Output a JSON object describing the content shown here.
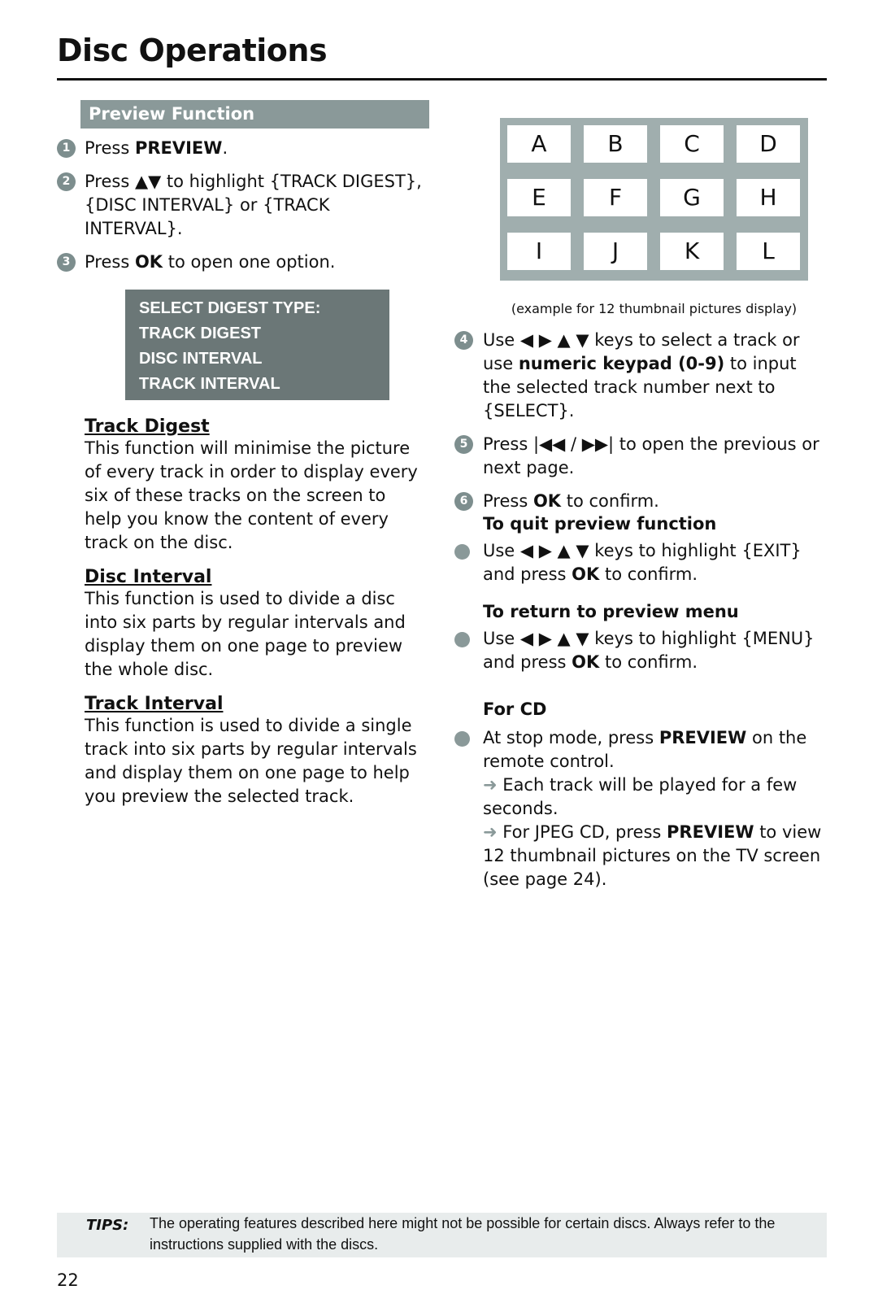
{
  "header": {
    "title": "Disc Operations"
  },
  "section": {
    "title": "Preview Function"
  },
  "steps_left": [
    {
      "num": "1",
      "pre": "Press ",
      "bold": "PREVIEW",
      "post": "."
    },
    {
      "num": "2",
      "text": "Press ▲▼ to highlight {TRACK DIGEST}, {DISC INTERVAL} or {TRACK INTERVAL}."
    },
    {
      "num": "3",
      "pre": "Press ",
      "bold": "OK",
      "post": " to open one option."
    }
  ],
  "menu": {
    "items": [
      "SELECT DIGEST TYPE:",
      "TRACK DIGEST",
      "DISC INTERVAL",
      "TRACK INTERVAL"
    ]
  },
  "descriptions": [
    {
      "heading": "Track Digest",
      "text": "This function will minimise the picture of every track in order to display every six of these tracks on the screen to help you know the content of every track on the disc."
    },
    {
      "heading": "Disc Interval",
      "text": "This function is used to divide a disc into six parts by regular intervals and display them on one page to preview the whole disc."
    },
    {
      "heading": "Track Interval",
      "text": "This function is used to divide a single track into six parts by regular intervals and display them on one page to help you preview the selected track."
    }
  ],
  "thumbnail_grid": {
    "cells": [
      "A",
      "B",
      "C",
      "D",
      "E",
      "F",
      "G",
      "H",
      "I",
      "J",
      "K",
      "L"
    ],
    "caption": "(example for 12 thumbnail pictures display)"
  },
  "steps_right": [
    {
      "num": "4",
      "pre": "Use ◀ ▶ ▲ ▼ keys to select a track or use ",
      "bold": "numeric keypad (0-9)",
      "post": " to input the selected track number next to {SELECT}."
    },
    {
      "num": "5",
      "text": "Press |◀◀ / ▶▶| to open the previous or next page."
    },
    {
      "num": "6",
      "pre": "Press ",
      "bold": "OK",
      "post": " to confirm."
    }
  ],
  "quit": {
    "heading": "To quit preview function",
    "pre": "Use ◀ ▶ ▲ ▼ keys to highlight {EXIT} and press ",
    "bold": "OK",
    "post": " to confirm."
  },
  "return": {
    "heading": "To return to preview menu",
    "pre": "Use ◀ ▶ ▲ ▼ keys to highlight {MENU} and press ",
    "bold": "OK",
    "post": " to confirm."
  },
  "cd": {
    "heading": "For CD",
    "pre": "At stop mode, press ",
    "bold": "PREVIEW",
    "post": " on the remote control.",
    "note1": "Each track will be played for a few seconds.",
    "note2_pre": "For JPEG CD, press ",
    "note2_bold": "PREVIEW",
    "note2_post": " to view 12 thumbnail pictures on the TV screen (see page 24).",
    "arrow": "➜"
  },
  "tips": {
    "label": "TIPS:",
    "text": "The operating features described here might not be possible for certain discs.  Always refer to the instructions supplied with the discs."
  },
  "footer": {
    "page_number": "22"
  }
}
